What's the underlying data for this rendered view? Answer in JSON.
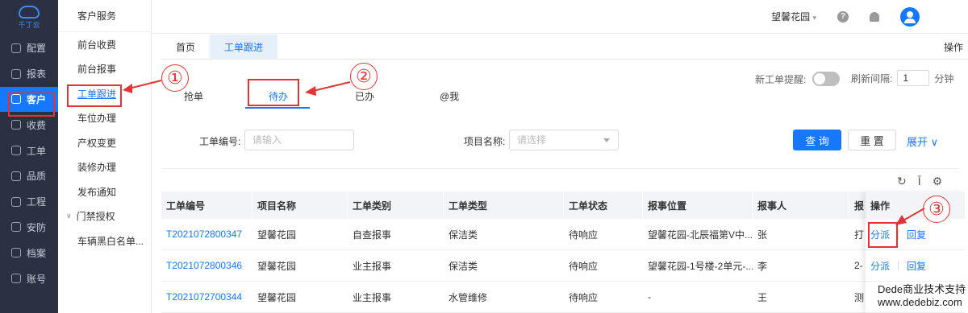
{
  "rail": {
    "logo_text": "千丁云",
    "items": [
      {
        "label": "配置",
        "icon": "gear-icon"
      },
      {
        "label": "报表",
        "icon": "report-icon"
      },
      {
        "label": "客户",
        "icon": "user-icon"
      },
      {
        "label": "收费",
        "icon": "wallet-icon"
      },
      {
        "label": "工单",
        "icon": "ticket-icon"
      },
      {
        "label": "品质",
        "icon": "shield-icon"
      },
      {
        "label": "工程",
        "icon": "monitor-icon"
      },
      {
        "label": "安防",
        "icon": "security-icon"
      },
      {
        "label": "档案",
        "icon": "archive-icon"
      },
      {
        "label": "账号",
        "icon": "account-icon"
      }
    ],
    "active_index": 2
  },
  "submenu": {
    "title": "客户服务",
    "items": [
      "前台收费",
      "前台报事",
      "工单跟进",
      "车位办理",
      "产权变更",
      "装修办理",
      "发布通知",
      "门禁授权",
      "车辆黑白名单..."
    ]
  },
  "header": {
    "project": "望馨花园",
    "help_glyph": "?"
  },
  "page_tabs": [
    "首页",
    "工单跟进"
  ],
  "page_tabs_right": "操作",
  "status_tabs": [
    "抢单",
    "待办",
    "已办",
    "@我"
  ],
  "controls": {
    "remind_label": "新工单提醒:",
    "interval_label": "刷新间隔:",
    "interval_value": "1",
    "interval_unit": "分钟"
  },
  "form": {
    "ticket_no_label": "工单编号:",
    "ticket_no_placeholder": "请输入",
    "project_label": "项目名称:",
    "project_placeholder": "请选择",
    "query_btn": "查 询",
    "reset_btn": "重 置",
    "expand_label": "展开 ∨"
  },
  "toolbar_icons": [
    "refresh-icon",
    "column-height-icon",
    "settings-icon"
  ],
  "table": {
    "headers": [
      "工单编号",
      "项目名称",
      "工单类别",
      "工单类型",
      "工单状态",
      "报事位置",
      "报事人",
      "报"
    ],
    "rows": [
      [
        "T2021072800347",
        "望馨花园",
        "自查报事",
        "保洁类",
        "待响应",
        "望馨花园-北辰福第V中...",
        "张",
        "打"
      ],
      [
        "T2021072800346",
        "望馨花园",
        "业主报事",
        "保洁类",
        "待响应",
        "望馨花园-1号楼-2单元-...",
        "李",
        "2-"
      ],
      [
        "T2021072700344",
        "望馨花园",
        "业主报事",
        "水管维修",
        "待响应",
        "-",
        "王",
        "测"
      ]
    ],
    "op_header": "操作",
    "op_actions": [
      "分派",
      "回复"
    ]
  },
  "annotations": [
    "①",
    "②",
    "③"
  ],
  "watermark": {
    "line1": "Dede商业技术支持",
    "line2": "www.dedebiz.com"
  },
  "colors": {
    "accent": "#1677ff",
    "rail_bg": "#2b3142",
    "annotation_red": "#e23434"
  }
}
